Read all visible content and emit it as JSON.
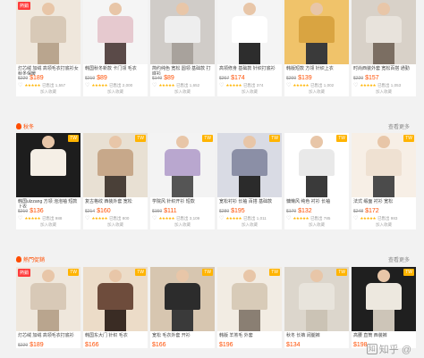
{
  "sections": [
    {
      "title": "",
      "more": "",
      "products": [
        {
          "title": "灯芯绒 加绒 高领毛衣打底衫女 秋冬保暖",
          "old": "$229",
          "price": "$189",
          "rating": "已售出 1,557",
          "tag": "",
          "hot": true,
          "colors": [
            "#d8c9b7",
            "#efe7dc",
            "#b9a58e"
          ]
        },
        {
          "title": "韩国秋冬新款 卡门领 毛衣",
          "old": "$219",
          "price": "$89",
          "rating": "已售出 2,000",
          "tag": "",
          "hot": false,
          "colors": [
            "#e6c9cf",
            "#f5f5f5",
            "#5a4a48"
          ]
        },
        {
          "title": "简约纯色 宽松 圆领 基础款 打底衫",
          "old": "$149",
          "price": "$89",
          "rating": "已售出 1,652",
          "tag": "",
          "hot": false,
          "colors": [
            "#eeeeee",
            "#d0ccc8",
            "#a8a29c"
          ]
        },
        {
          "title": "高领修身 基础款 针织打底衫",
          "old": "$267",
          "price": "$174",
          "rating": "已售出 374",
          "tag": "",
          "hot": false,
          "colors": [
            "#ffffff",
            "#f4f4f4",
            "#2d2d2d"
          ]
        },
        {
          "title": "韩版短款 方领 针织上衣",
          "old": "$209",
          "price": "$139",
          "rating": "已售出 1,002",
          "tag": "",
          "hot": false,
          "colors": [
            "#d9a441",
            "#f0c36a",
            "#3a3a3a"
          ]
        },
        {
          "title": "时尚西装外套 宽松百搭 通勤",
          "old": "$229",
          "price": "$157",
          "rating": "已售出 1,053",
          "tag": "",
          "hot": false,
          "colors": [
            "#e8e3dc",
            "#d8d1c8",
            "#7b6e62"
          ]
        }
      ]
    },
    {
      "title": "秋冬",
      "more": "查看更多",
      "products": [
        {
          "title": "韩国ulzzang 方领 泡泡袖 短款 上衣",
          "old": "$219",
          "price": "$136",
          "rating": "已售出 988",
          "tag": "TW",
          "hot": false,
          "colors": [
            "#f5efe6",
            "#1d1d1d",
            "#1d1d1d"
          ]
        },
        {
          "title": "复古格纹 西装外套 宽松",
          "old": "$214",
          "price": "$160",
          "rating": "已售出 800",
          "tag": "TW",
          "hot": false,
          "colors": [
            "#c7a88a",
            "#e8e0d3",
            "#4a4038"
          ]
        },
        {
          "title": "学院风 针织开衫 短款",
          "old": "$159",
          "price": "$111",
          "rating": "已售出 3,109",
          "tag": "TW",
          "hot": false,
          "colors": [
            "#b9a7cf",
            "#f3f3f3",
            "#555555"
          ]
        },
        {
          "title": "宽松衬衫 长袖 百搭 基础款",
          "old": "$289",
          "price": "$195",
          "rating": "已售出 1,011",
          "tag": "TW",
          "hot": false,
          "colors": [
            "#8b8fa6",
            "#d9dbe4",
            "#2b2b2b"
          ]
        },
        {
          "title": "慵懒风 纯色 衬衫 长袖",
          "old": "$179",
          "price": "$132",
          "rating": "已售出 785",
          "tag": "TW",
          "hot": false,
          "colors": [
            "#e9e9e9",
            "#ffffff",
            "#3a3a3a"
          ]
        },
        {
          "title": "法式 缎面 衬衫 宽松",
          "old": "$248",
          "price": "$172",
          "rating": "已售出 983",
          "tag": "TW",
          "hot": false,
          "colors": [
            "#efe1d2",
            "#f7efe6",
            "#4b4b4b"
          ]
        }
      ]
    },
    {
      "title": "熱門促銷",
      "more": "查看更多",
      "products": [
        {
          "title": "灯芯绒 加绒 高领毛衣打底衫",
          "old": "$229",
          "price": "$189",
          "rating": "",
          "tag": "TW",
          "hot": true,
          "colors": [
            "#d8c9b7",
            "#efe7dc",
            "#b9a58e"
          ]
        },
        {
          "title": "韩国东大门 针织 毛衣",
          "old": "",
          "price": "$166",
          "rating": "",
          "tag": "TW",
          "hot": false,
          "colors": [
            "#6e4c3c",
            "#ecdcc8",
            "#3a2c24"
          ]
        },
        {
          "title": "宽松 毛衣外套 开衫",
          "old": "",
          "price": "$166",
          "rating": "",
          "tag": "TW",
          "hot": false,
          "colors": [
            "#2c2c2c",
            "#d7c6b0",
            "#3a3a3a"
          ]
        },
        {
          "title": "韩版 羊羔毛 外套",
          "old": "",
          "price": "$196",
          "rating": "",
          "tag": "TW",
          "hot": false,
          "colors": [
            "#d8cbb8",
            "#f2ece3",
            "#8a7f73"
          ]
        },
        {
          "title": "秋冬 长裤 阔腿裤",
          "old": "",
          "price": "$134",
          "rating": "",
          "tag": "TW",
          "hot": false,
          "colors": [
            "#e8e4dc",
            "#dcd6cc",
            "#cbc3b5"
          ]
        },
        {
          "title": "高腰 直筒 西装裤",
          "old": "",
          "price": "$198",
          "rating": "",
          "tag": "TW",
          "hot": false,
          "colors": [
            "#ede8df",
            "#1f1f1f",
            "#cdc5b8"
          ]
        }
      ]
    }
  ],
  "labels": {
    "fav": "加入收藏",
    "hot": "熱銷"
  },
  "watermark": "知乎 @"
}
